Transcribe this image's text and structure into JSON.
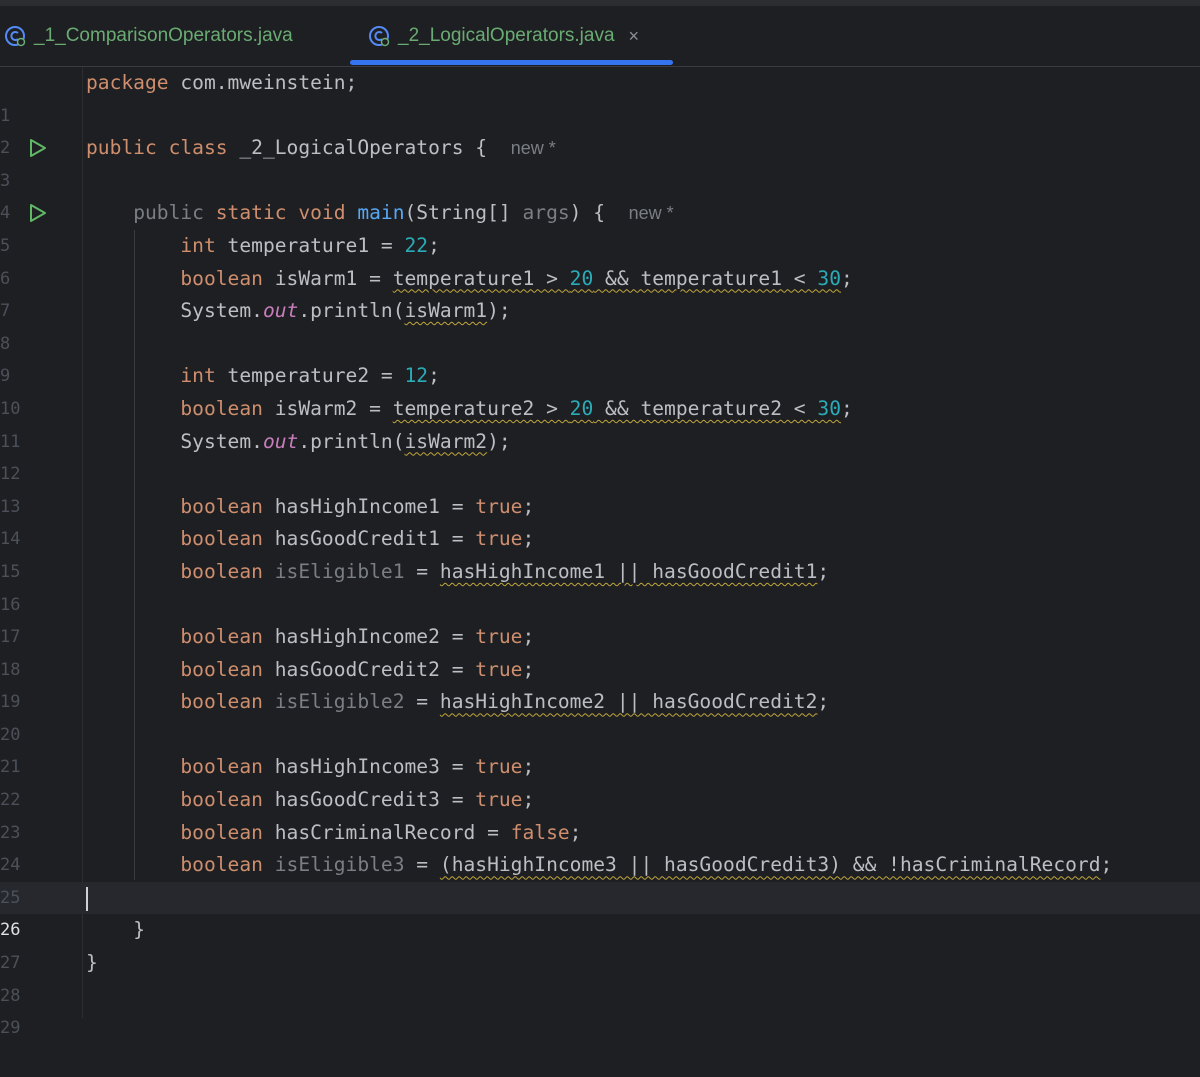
{
  "tabs": [
    {
      "label": "_1_ComparisonOperators.java",
      "active": false
    },
    {
      "label": "_2_LogicalOperators.java",
      "active": true
    }
  ],
  "tab_close": "×",
  "inlay_hint": "new *",
  "line_numbers": [
    "1",
    "2",
    "3",
    "4",
    "5",
    "6",
    "7",
    "8",
    "9",
    "10",
    "11",
    "12",
    "13",
    "14",
    "15",
    "16",
    "17",
    "18",
    "19",
    "20",
    "21",
    "22",
    "23",
    "24",
    "25",
    "26",
    "27",
    "28",
    "29"
  ],
  "code": {
    "package_kw": "package",
    "package_name": " com.mweinstein;",
    "public": "public",
    "class": "class",
    "class_name": " _2_LogicalOperators { ",
    "static": "static",
    "void": "void",
    "main": "main",
    "main_params_a": "(String[] ",
    "args": "args",
    "main_params_b": ") { ",
    "int": "int",
    "boolean": "boolean",
    "true": "true",
    "false": "false",
    "system": "System.",
    "out": "out",
    "println": ".println(",
    "l6_name": " temperature1 = ",
    "l6_val": "22",
    "l7_name": " isWarm1 = ",
    "l7_expr_a": "temperature1 > ",
    "l7_num1": "20",
    "l7_expr_b": " && temperature1 < ",
    "l7_num2": "30",
    "l8_arg": "isWarm1",
    "l10_name": " temperature2 = ",
    "l10_val": "12",
    "l11_name": " isWarm2 = ",
    "l11_expr_a": "temperature2 > ",
    "l11_num1": "20",
    "l11_expr_b": " && temperature2 < ",
    "l11_num2": "30",
    "l12_arg": "isWarm2",
    "l14": " hasHighIncome1 = ",
    "l15": " hasGoodCredit1 = ",
    "l16_name": "isEligible1",
    "l16_expr": "hasHighIncome1 || hasGoodCredit1",
    "l18": " hasHighIncome2 = ",
    "l19": " hasGoodCredit2 = ",
    "l20_name": "isEligible2",
    "l20_expr": "hasHighIncome2 || hasGoodCredit2",
    "l22": " hasHighIncome3 = ",
    "l23": " hasGoodCredit3 = ",
    "l24": " hasCriminalRecord = ",
    "l25_name": "isEligible3",
    "l25_expr": "(hasHighIncome3 || hasGoodCredit3) && !hasCriminalRecord",
    "semi": ";",
    "close_paren_semi": ");",
    "eq": " = ",
    "close_brace": "}"
  },
  "colors": {
    "background": "#1e1f22",
    "keyword": "#cf8e6d",
    "number": "#2aacb8",
    "method": "#56a8f5",
    "static_field": "#c77dbb",
    "tab_text": "#6aab73",
    "tab_underline": "#3574f0"
  },
  "icons": {
    "tab_file": "java-class-icon",
    "run": "run-triangle-icon"
  }
}
